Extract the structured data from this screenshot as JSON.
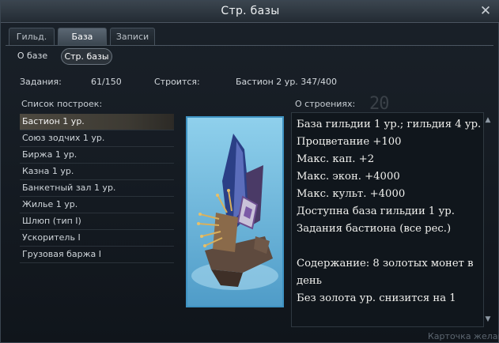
{
  "window": {
    "title": "Стр. базы",
    "close_label": "✕"
  },
  "tabs": [
    {
      "label": "Гильд.",
      "active": false
    },
    {
      "label": "База",
      "active": true
    },
    {
      "label": "Записи",
      "active": false
    }
  ],
  "subtabs": [
    {
      "label": "О базе",
      "active": false
    },
    {
      "label": "Стр. базы",
      "active": true
    }
  ],
  "stats": {
    "quests_label": "Задания:",
    "quests_value": "61/150",
    "building_label": "Строится:",
    "building_value": "Бастион 2 ур. 347/400"
  },
  "buildings": {
    "label": "Список построек:",
    "items": [
      {
        "label": "Бастион 1 ур.",
        "selected": true
      },
      {
        "label": "Союз зодчих 1 ур."
      },
      {
        "label": "Биржа 1 ур."
      },
      {
        "label": "Казна 1 ур."
      },
      {
        "label": "Банкетный зал 1 ур."
      },
      {
        "label": "Жилье 1 ур."
      },
      {
        "label": "Шлюп (тип I)"
      },
      {
        "label": "Ускоритель I"
      },
      {
        "label": "Грузовая баржа I"
      }
    ]
  },
  "info": {
    "label": "О строениях:",
    "background_number": "20",
    "lines": [
      "База гильдии 1 ур.; гильдия 4 ур.",
      "Процветание +100",
      "Макс. кап. +2",
      "Макс. экон. +4000",
      "Макс. культ. +4000",
      "Доступна база гильдии 1 ур.",
      "Задания бастиона (все рес.)",
      "",
      "Содержание: 8 золотых монет в",
      "день",
      "Без золота ур. снизится на 1"
    ]
  },
  "footer": {
    "text": "Карточка желани"
  },
  "colors": {
    "accent": "#3e92c2",
    "selected_row": "#4d4940"
  }
}
